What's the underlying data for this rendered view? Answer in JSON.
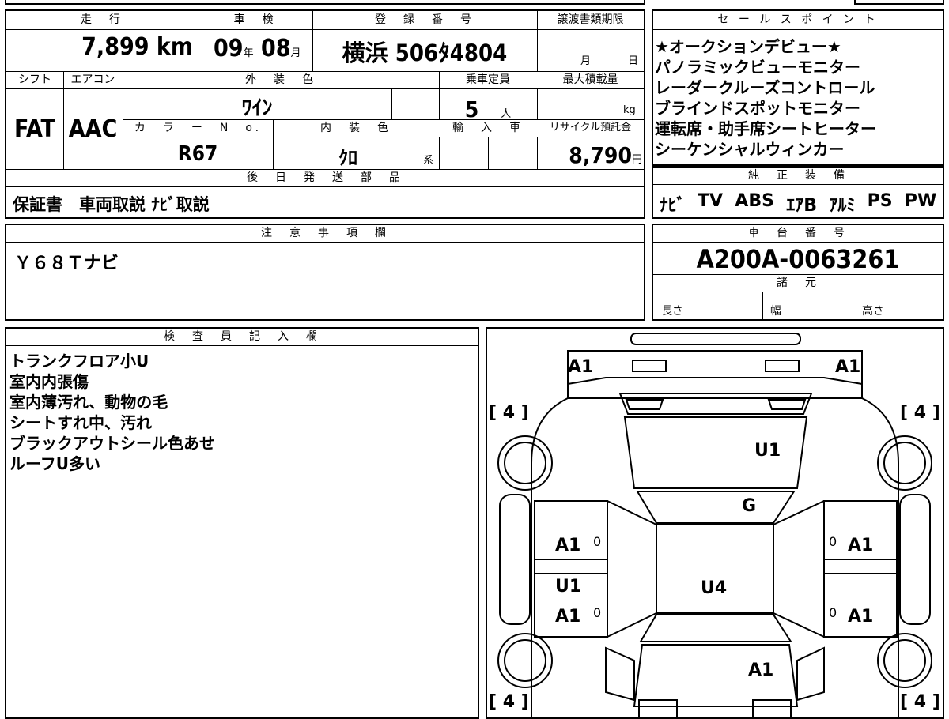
{
  "top_table": {
    "mileage_label": "走　行",
    "mileage_value": "7,899",
    "mileage_unit": "km",
    "shaken_label": "車　検",
    "shaken_year": "09",
    "shaken_year_unit": "年",
    "shaken_month": "08",
    "shaken_month_unit": "月",
    "reg_label": "登　録　番　号",
    "reg_value": "横浜 506ﾀ4804",
    "transfer_label": "譲渡書類期限",
    "transfer_month_unit": "月",
    "transfer_day_unit": "日",
    "shift_label": "シフト",
    "shift_value": "FAT",
    "ac_label": "エアコン",
    "ac_value": "AAC",
    "ext_color_label": "外　装　色",
    "ext_color_value": "ﾜｲﾝ",
    "capacity_label": "乗車定員",
    "capacity_value": "5",
    "capacity_unit": "人",
    "max_load_label": "最大積載量",
    "max_load_unit": "kg",
    "color_no_label": "カ　ラ　ー　N　o.",
    "color_no_value": "R67",
    "int_color_label": "内　装　色",
    "int_color_value": "ｸﾛ",
    "int_color_unit": "系",
    "import_label": "輸　入　車",
    "recycle_label": "リサイクル預託金",
    "recycle_value": "8,790",
    "recycle_unit": "円",
    "later_parts_label": "後　日　発　送　部　品",
    "later_parts_value": "保証書　車両取説 ﾅﾋﾞ取説"
  },
  "sales_points": {
    "label": "セ ー ル ス ポ イ ン ト",
    "items": [
      "★オークションデビュー★",
      "パノラミックビューモニター",
      "レーダークルーズコントロール",
      "ブラインドスポットモニター",
      "運転席・助手席シートヒーター",
      "シーケンシャルウィンカー"
    ]
  },
  "genuine_equipment": {
    "label": "純　正　装　備",
    "items": [
      "ﾅﾋﾞ",
      "TV",
      "ABS",
      "ｴｱB",
      "ｱﾙﾐ",
      "PS",
      "PW"
    ]
  },
  "notes": {
    "label": "注　意　事　項　欄",
    "value": "Ｙ６８Ｔナビ"
  },
  "chassis": {
    "label": "車　台　番　号",
    "value": "A200A-0063261",
    "specs_label": "諸　元",
    "length_label": "長さ",
    "width_label": "幅",
    "height_label": "高さ"
  },
  "inspector": {
    "label": "検　査　員　記　入　欄",
    "lines": [
      "トランクフロア小U",
      "室内内張傷",
      "室内薄汚れ、動物の毛",
      "シートすれ中、汚れ",
      "ブラックアウトシール色あせ",
      "ルーフU多い"
    ]
  },
  "diagram": {
    "marks": {
      "front_left": "A1",
      "front_right": "A1",
      "tire_fl": "4",
      "tire_fr": "4",
      "tire_rl": "4",
      "tire_rr": "4",
      "hood": "U1",
      "windshield": "G",
      "left_front_door": "A1",
      "left_front_zero": "0",
      "right_front_door": "A1",
      "right_front_zero": "0",
      "left_rear_upper": "U1",
      "left_rear_door": "A1",
      "left_rear_zero": "0",
      "right_rear_door": "A1",
      "right_rear_zero": "0",
      "roof": "U4",
      "rear": "A1"
    }
  }
}
